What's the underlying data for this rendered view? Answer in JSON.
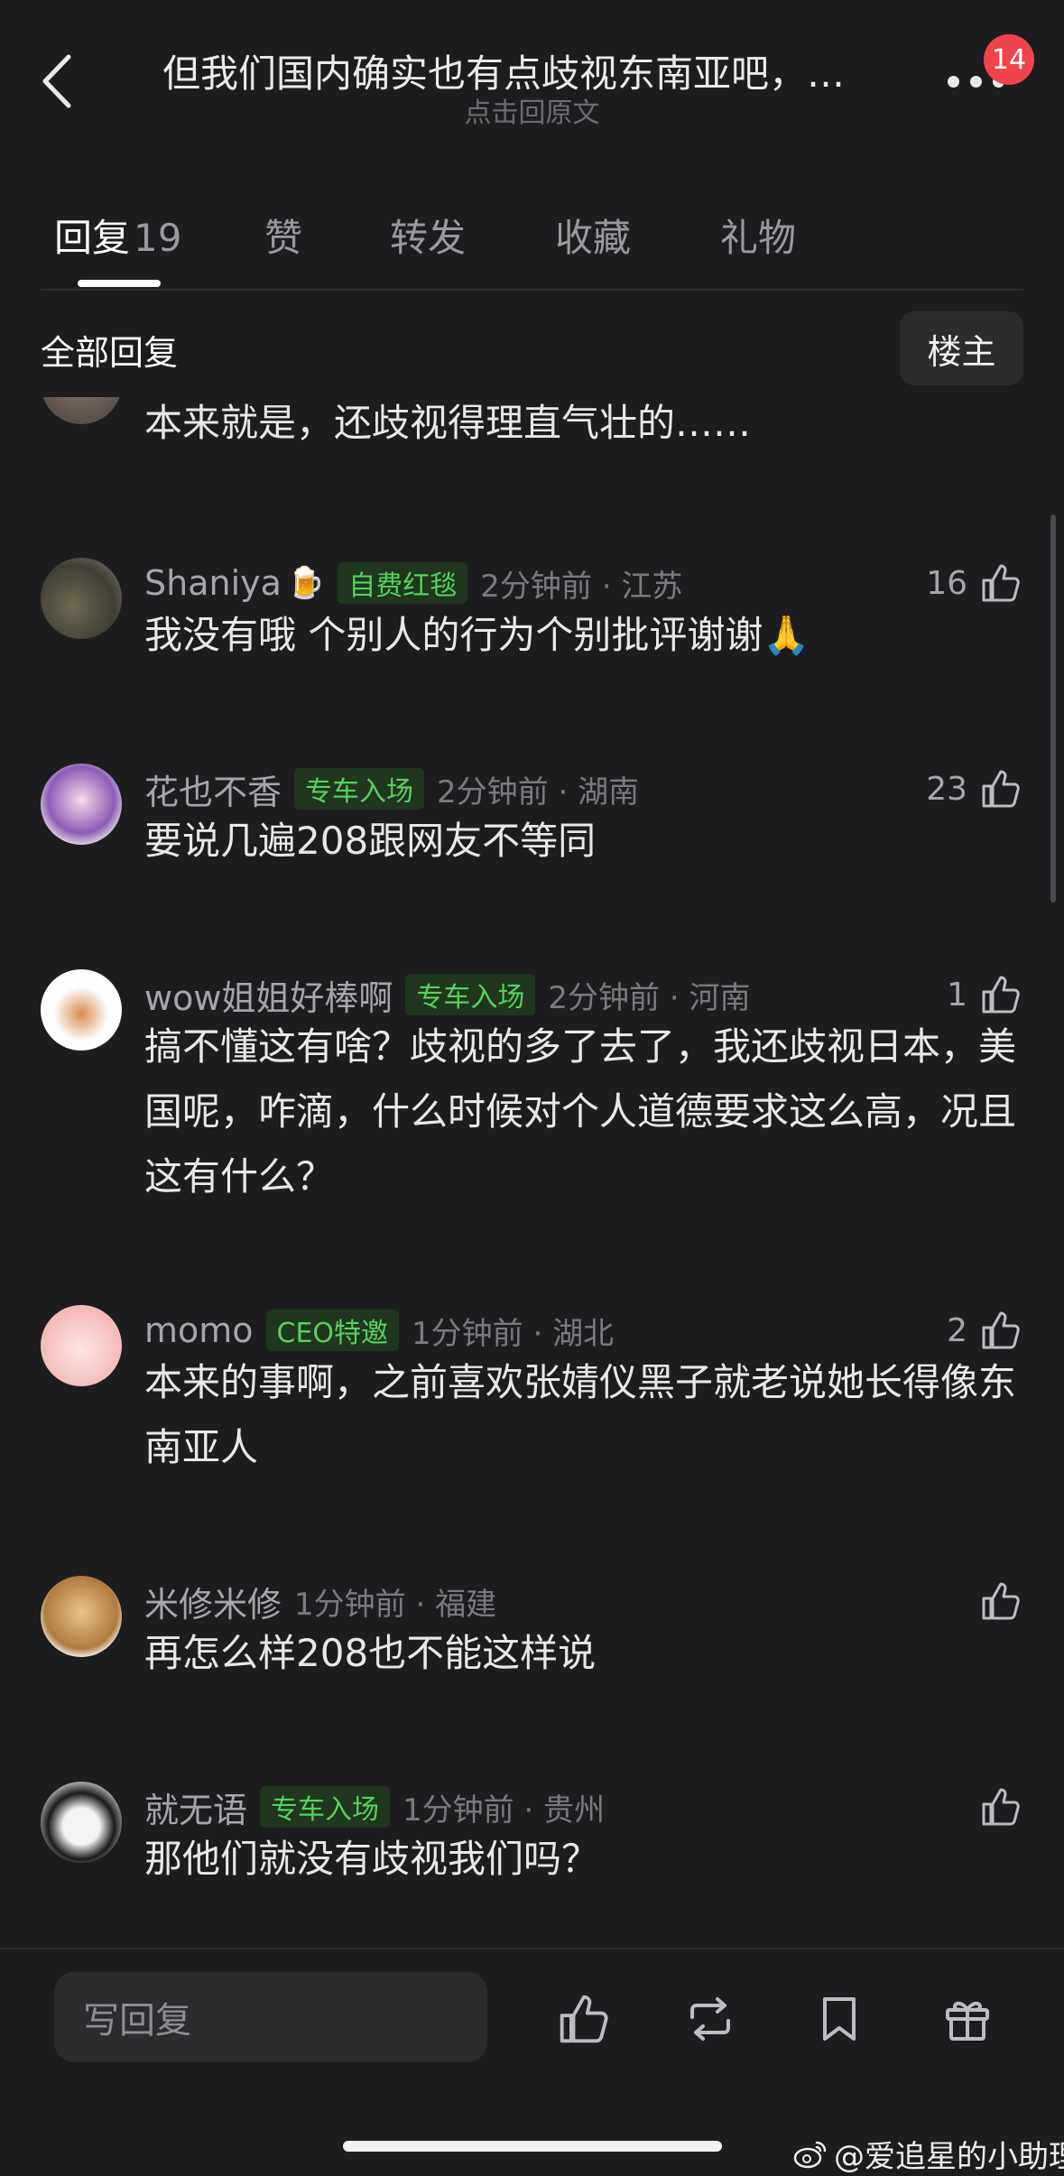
{
  "header": {
    "title": "但我们国内确实也有点歧视东南亚吧，…",
    "subtitle": "点击回原文",
    "notification_count": "14"
  },
  "tabs": [
    {
      "label": "回复",
      "count": "19",
      "active": true
    },
    {
      "label": "赞"
    },
    {
      "label": "转发"
    },
    {
      "label": "收藏"
    },
    {
      "label": "礼物"
    }
  ],
  "filter": {
    "all_replies_label": "全部回复",
    "op_button_label": "楼主"
  },
  "comments": [
    {
      "text": "本来就是，还歧视得理直气壮的……"
    },
    {
      "username": "Shaniya",
      "emoji": "🍺",
      "tag": "自费红毯",
      "time": "2分钟前 · 江苏",
      "likes": "16",
      "text": "我没有哦 个别人的行为个别批评谢谢🙏"
    },
    {
      "username": "花也不香",
      "tag": "专车入场",
      "time": "2分钟前 · 湖南",
      "likes": "23",
      "text": "要说几遍208跟网友不等同"
    },
    {
      "username": "wow姐姐好棒啊",
      "tag": "专车入场",
      "time": "2分钟前 · 河南",
      "likes": "1",
      "text": "搞不懂这有啥？歧视的多了去了，我还歧视日本，美国呢，咋滴，什么时候对个人道德要求这么高，况且这有什么？"
    },
    {
      "username": "momo",
      "tag": "CEO特邀",
      "time": "1分钟前 · 湖北",
      "likes": "2",
      "text": "本来的事啊，之前喜欢张婧仪黑子就老说她长得像东南亚人"
    },
    {
      "username": "米修米修",
      "time": "1分钟前 · 福建",
      "likes": "",
      "text": "再怎么样208也不能这样说"
    },
    {
      "username": "就无语",
      "tag": "专车入场",
      "time": "1分钟前 · 贵州",
      "likes": "",
      "text": "那他们就没有歧视我们吗？"
    }
  ],
  "bottom_bar": {
    "reply_placeholder": "写回复"
  },
  "watermark": "@爱追星的小助理",
  "colors": {
    "background": "#1d1d1f",
    "tag_green": "#56d15c",
    "badge_red": "#f0444d"
  }
}
